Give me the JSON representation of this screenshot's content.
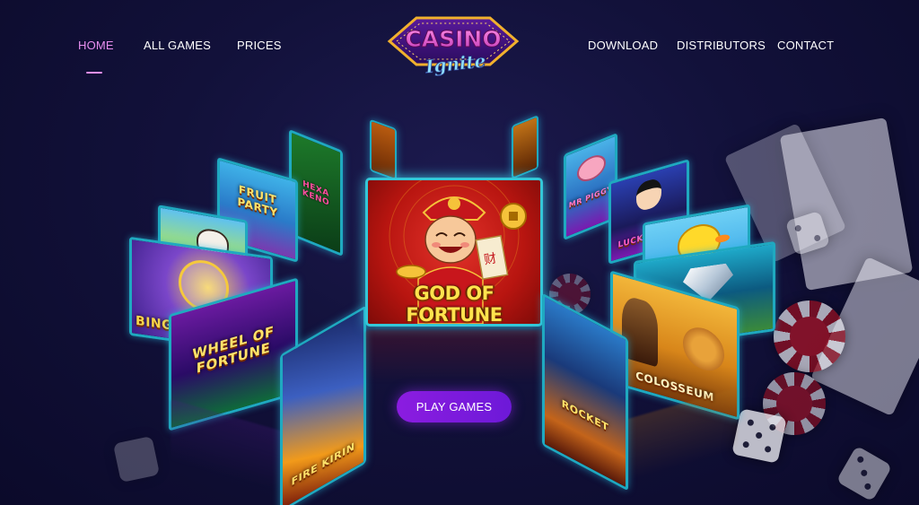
{
  "nav": {
    "left": [
      {
        "label": "HOME",
        "active": true
      },
      {
        "label": "ALL GAMES",
        "active": false
      },
      {
        "label": "PRICES",
        "active": false
      }
    ],
    "right": [
      {
        "label": "DOWNLOAD"
      },
      {
        "label": "DISTRIBUTORS"
      },
      {
        "label": "CONTACT"
      }
    ]
  },
  "logo": {
    "line1": "CASINO",
    "line2": "Ignite"
  },
  "featured_game": {
    "title": "GOD OF FORTUNE",
    "scroll_glyph": "财"
  },
  "games": {
    "fruit_party": "FRUIT PARTY",
    "hexa_keno": "HEXA KENO",
    "cow": "",
    "bingo": "BINGO",
    "wheel_of_fortune": "WHEEL OF FORTUNE",
    "fire_kirin": "FIRE KIRIN",
    "piggy": "MR PIGGY",
    "lady": "LUCKY",
    "duck": "",
    "diamond": "",
    "colosseum": "COLOSSEUM",
    "rocket": "ROCKET"
  },
  "cta": {
    "label": "PLAY GAMES"
  },
  "colors": {
    "background": "#12113a",
    "active_link": "#e98ff0",
    "cta": "#7b1adf",
    "tile_border": "#1fa9c0"
  }
}
